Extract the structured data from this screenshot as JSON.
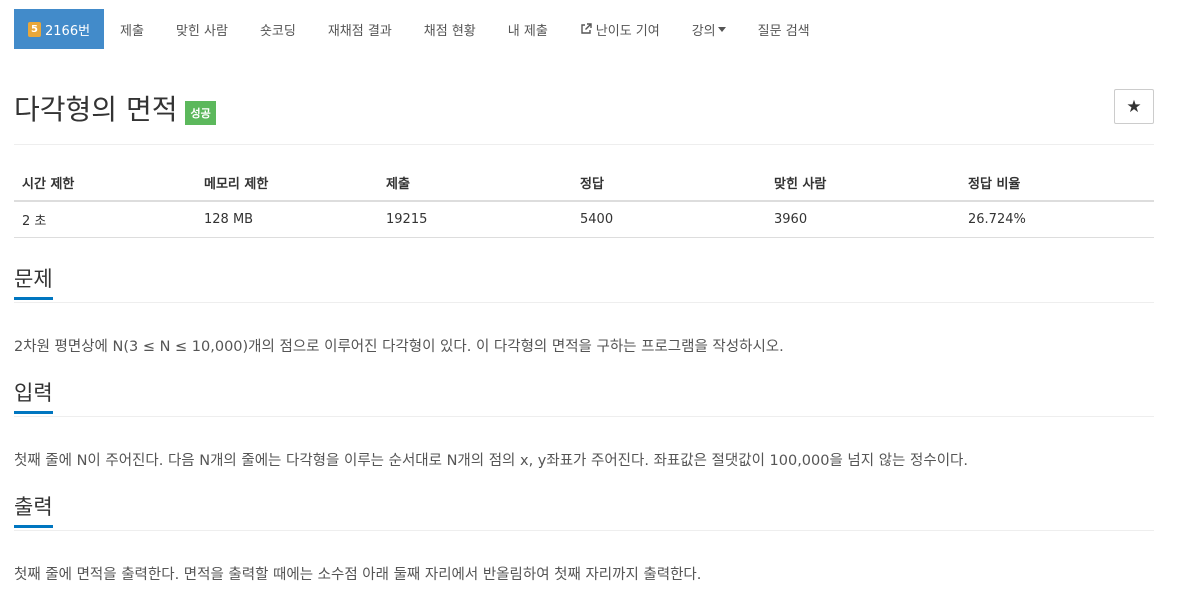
{
  "nav": {
    "problem_number": "2166번",
    "tier_badge": "5",
    "items": [
      "제출",
      "맞힌 사람",
      "숏코딩",
      "재채점 결과",
      "채점 현황",
      "내 제출",
      "난이도 기여",
      "강의",
      "질문 검색"
    ]
  },
  "problem": {
    "title": "다각형의 면적",
    "status": "성공",
    "star": "★"
  },
  "stats": {
    "headers": [
      "시간 제한",
      "메모리 제한",
      "제출",
      "정답",
      "맞힌 사람",
      "정답 비율"
    ],
    "values": [
      "2 초",
      "128 MB",
      "19215",
      "5400",
      "3960",
      "26.724%"
    ]
  },
  "sections": {
    "problem_heading": "문제",
    "problem_text": "2차원 평면상에 N(3 ≤ N ≤ 10,000)개의 점으로 이루어진 다각형이 있다. 이 다각형의 면적을 구하는 프로그램을 작성하시오.",
    "input_heading": "입력",
    "input_text": "첫째 줄에 N이 주어진다. 다음 N개의 줄에는 다각형을 이루는 순서대로 N개의 점의 x, y좌표가 주어진다. 좌표값은 절댓값이 100,000을 넘지 않는 정수이다.",
    "output_heading": "출력",
    "output_text": "첫째 줄에 면적을 출력한다. 면적을 출력할 때에는 소수점 아래 둘째 자리에서 반올림하여 첫째 자리까지 출력한다."
  },
  "colors": {
    "nav_active": "#428bca",
    "tier_badge": "#e8a73a",
    "success": "#5cb85c",
    "section_underline": "#0076c0"
  }
}
